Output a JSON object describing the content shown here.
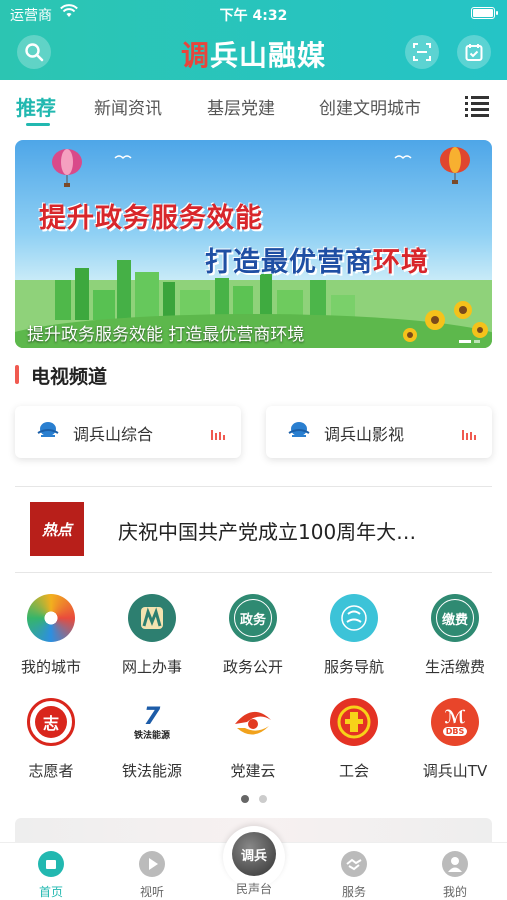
{
  "status_bar": {
    "carrier": "运营商",
    "time": "下午 4:32"
  },
  "header": {
    "brand_prefix": "调",
    "brand_rest": "兵山融媒",
    "icons": [
      "search-icon",
      "scan-icon",
      "calendar-check-icon"
    ]
  },
  "tabs": [
    {
      "label": "推荐",
      "active": true
    },
    {
      "label": "新闻资讯",
      "active": false
    },
    {
      "label": "基层党建",
      "active": false
    },
    {
      "label": "创建文明城市",
      "active": false
    }
  ],
  "banner": {
    "line1": "提升政务服务效能",
    "line2_a": "打造最优营商",
    "line2_b": "环境",
    "caption": "提升政务服务效能 打造最优营商环境"
  },
  "tv_section": {
    "title": "电视频道",
    "channels": [
      {
        "name": "调兵山综合"
      },
      {
        "name": "调兵山影视"
      }
    ]
  },
  "hot_news": {
    "badge": "热点",
    "text": "庆祝中国共产党成立100周年大…"
  },
  "services": [
    {
      "label": "我的城市",
      "icon": "my-city-icon"
    },
    {
      "label": "网上办事",
      "icon": "online-service-icon"
    },
    {
      "label": "政务公开",
      "icon": "government-affairs-icon",
      "glyph": "政务"
    },
    {
      "label": "服务导航",
      "icon": "service-nav-icon"
    },
    {
      "label": "生活缴费",
      "icon": "bill-payment-icon",
      "glyph": "缴费"
    },
    {
      "label": "志愿者",
      "icon": "volunteer-icon",
      "glyph": "志"
    },
    {
      "label": "铁法能源",
      "icon": "tiefa-energy-icon",
      "glyph": "铁法能源"
    },
    {
      "label": "党建云",
      "icon": "party-cloud-icon"
    },
    {
      "label": "工会",
      "icon": "union-icon"
    },
    {
      "label": "调兵山TV",
      "icon": "tv-icon",
      "glyph": "DBS"
    }
  ],
  "pager": {
    "pages": 2,
    "current": 1
  },
  "bottom_nav": [
    {
      "label": "首页",
      "icon": "home-icon",
      "active": true
    },
    {
      "label": "视听",
      "icon": "play-icon",
      "active": false
    },
    {
      "label": "民声台",
      "icon": "voice-platform-icon",
      "active": false,
      "center_glyph": "调兵"
    },
    {
      "label": "服务",
      "icon": "handshake-icon",
      "active": false
    },
    {
      "label": "我的",
      "icon": "profile-icon",
      "active": false
    }
  ],
  "colors": {
    "primary": "#22b8b0",
    "accent_red": "#e8453c"
  }
}
